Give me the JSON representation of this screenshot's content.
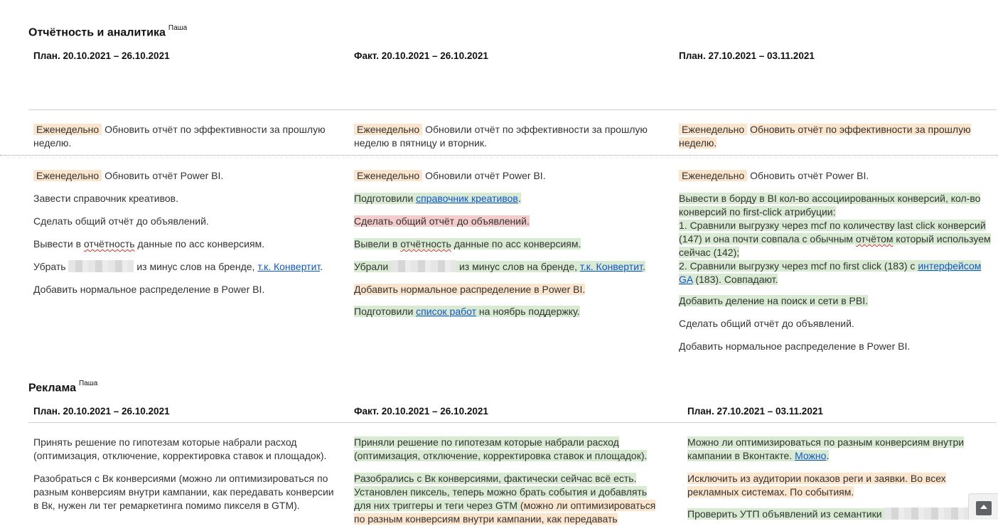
{
  "sections": [
    {
      "title": "Отчётность и аналитика",
      "author": "Паша",
      "cols": [
        "План. 20.10.2021 – 26.10.2021",
        "Факт.  20.10.2021 – 26.10.2021",
        "План. 27.10.2021 – 03.11.2021"
      ]
    },
    {
      "title": "Реклама",
      "author": "Паша",
      "cols": [
        "План. 20.10.2021 – 26.10.2021",
        "Факт.  20.10.2021 – 26.10.2021",
        "План. 27.10.2021 – 03.11.2021"
      ]
    }
  ],
  "tags": {
    "weekly": "Еженедельно"
  },
  "s1": {
    "c1": {
      "r1_text": "Обновить отчёт по эффективности за прошлую неделю.",
      "r2_text": "Обновить отчёт Power BI.",
      "p2": "Завести справочник креативов.",
      "p3": "Сделать общий отчёт до объявлений.",
      "p4a": "Вывести в ",
      "p4b": "отчётность",
      "p4c": " данные по асс конверсиям.",
      "p5a": "Убрать",
      "p5b": " из минус слов на бренде, ",
      "p5link": "т.к. Конвертит",
      "p5c": ".",
      "p6": "Добавить нормальное распределение в Power BI."
    },
    "c2": {
      "r1_text": "Обновили отчёт по эффективности за прошлую неделю в пятницу и вторник.",
      "r2_text": "Обновили отчёт Power BI.",
      "p2a": "Подготовили ",
      "p2link": "справочник креативов",
      "p2b": ".",
      "p3": "Сделать общий отчёт до объявлений.",
      "p4a": "Вывели в ",
      "p4b": "отчётность",
      "p4c": " данные по асс конверсиям.",
      "p5a": "Убрали",
      "p5b": " из минус слов на бренде, ",
      "p5link": "т.к. Конвертит",
      "p5c": ".",
      "p6": "Добавить нормальное распределение в Power BI.",
      "p7a": "Подготовили ",
      "p7link": "список работ",
      "p7b": " на ноябрь поддержку."
    },
    "c3": {
      "r1_text": "Обновить отчёт по эффективности за прошлую неделю.",
      "r2_text": "Обновить отчёт Power BI.",
      "p2_l1": "Вывести в борду в BI кол-во ассоциированных конверсий, кол-во конверсий по first-click атрибуции:",
      "p2_l2a": "1. Сравнили выгрузку через mcf по количеству last click конверсий (147) и она почти совпала с обычным ",
      "p2_l2b": "отчётом",
      "p2_l2c": " который используем сейчас (142);",
      "p2_l3a": "2. Сравнили выгрузку через mcf по first click (183) с ",
      "p2_l3link": "интерфейсом GA",
      "p2_l3b": " (183). Совпадают.",
      "p3": "Добавить деление на поиск и сети в PBI.",
      "p4": "Сделать общий отчёт до объявлений.",
      "p5": "Добавить нормальное распределение в Power BI."
    }
  },
  "s2": {
    "c1": {
      "p1": "Принять решение по гипотезам которые набрали расход (оптимизация, отключение, корректировка ставок и площадок).",
      "p2": "Разобраться с Вк конверсиями (можно ли оптимизироваться по разным конверсиям внутри кампании, как передавать конверсии в Вк, нужен ли тег ремаркетинга помимо пикселя в GTM)."
    },
    "c2": {
      "p1": "Приняли решение по гипотезам которые набрали расход (оптимизация, отключение, корректировка ставок и площадок).",
      "p2a": "Разобрались с Вк конверсиями, фактически сейчас всё есть. Установлен пиксель, теперь можно брать события и добавлять для них триггеры и теги через GTM ",
      "p2b": "(можно ли оптимизироваться по разным конверсиям внутри кампании, как передавать"
    },
    "c3": {
      "p1a": "Можно ли оптимизироваться по разным конверсиям внутри кампании в Вконтакте. ",
      "p1link": "Можно",
      "p1b": ".",
      "p2": "Исключить из аудитории показов реги и заявки. Во всех рекламных системах. По событиям.",
      "p3": "Проверить УТП объявлений из семантики"
    }
  }
}
